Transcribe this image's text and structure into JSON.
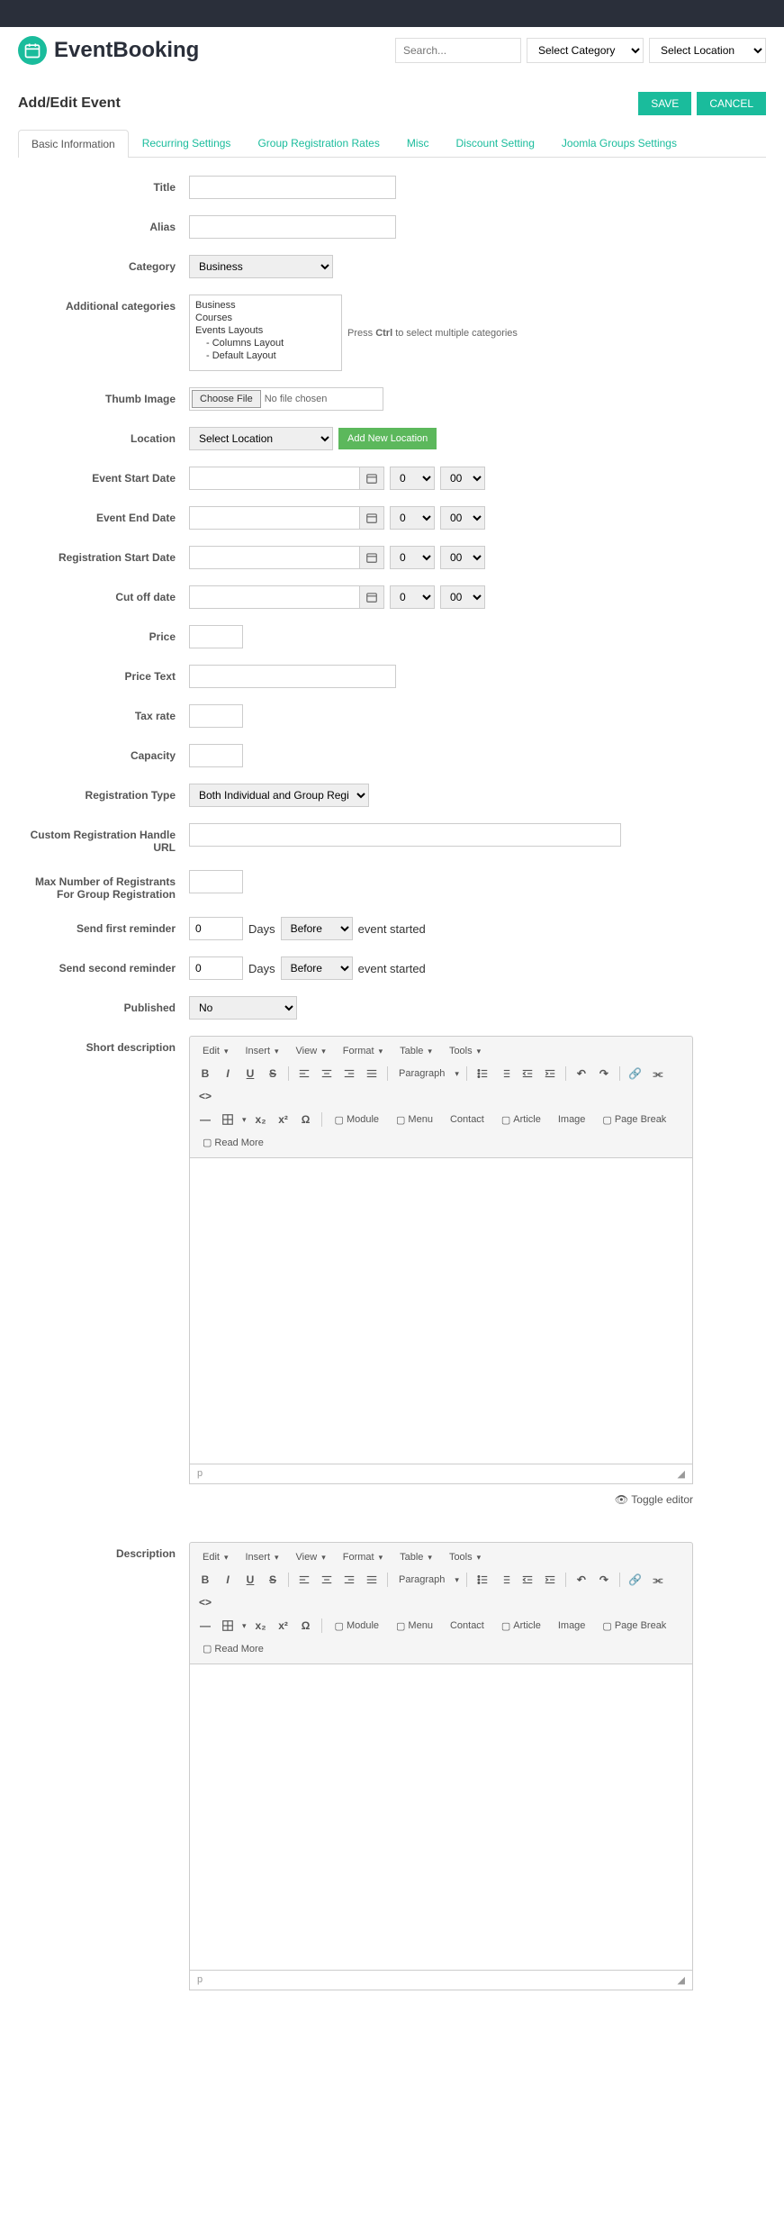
{
  "app_name": "EventBooking",
  "header": {
    "search_placeholder": "Search...",
    "category_placeholder": "Select Category",
    "location_placeholder": "Select Location"
  },
  "page_title": "Add/Edit Event",
  "buttons": {
    "save": "SAVE",
    "cancel": "CANCEL",
    "add_location": "Add New Location",
    "choose_file": "Choose File",
    "no_file": "No file chosen",
    "toggle_editor": "Toggle editor"
  },
  "tabs": [
    "Basic Information",
    "Recurring Settings",
    "Group Registration Rates",
    "Misc",
    "Discount Setting",
    "Joomla Groups Settings"
  ],
  "labels": {
    "title": "Title",
    "alias": "Alias",
    "category": "Category",
    "additional_categories": "Additional categories",
    "thumb_image": "Thumb Image",
    "location": "Location",
    "event_start_date": "Event Start Date",
    "event_end_date": "Event End Date",
    "registration_start_date": "Registration Start Date",
    "cut_off_date": "Cut off date",
    "price": "Price",
    "price_text": "Price Text",
    "tax_rate": "Tax rate",
    "capacity": "Capacity",
    "registration_type": "Registration Type",
    "custom_reg_url": "Custom Registration Handle URL",
    "max_registrants": "Max Number of Registrants For Group Registration",
    "send_first_reminder": "Send first reminder",
    "send_second_reminder": "Send second reminder",
    "published": "Published",
    "short_description": "Short description",
    "description": "Description"
  },
  "values": {
    "category": "Business",
    "additional_categories": [
      "Business",
      "Courses",
      "Events Layouts",
      "- Columns Layout",
      "- Default Layout"
    ],
    "additional_hint_pre": "Press ",
    "additional_hint_key": "Ctrl",
    "additional_hint_post": " to select multiple categories",
    "location": "Select Location",
    "registration_type": "Both Individual and Group Registration",
    "published": "No",
    "reminder_days_1": "0",
    "reminder_days_2": "0",
    "reminder_when_1": "Before",
    "reminder_when_2": "Before",
    "days_label": "Days",
    "event_started": "event started",
    "hour_default": "0",
    "minute_default": "00",
    "editor_status": "p"
  },
  "editor": {
    "menus": [
      "Edit",
      "Insert",
      "View",
      "Format",
      "Table",
      "Tools"
    ],
    "paragraph": "Paragraph",
    "buttons": {
      "module": "Module",
      "menu": "Menu",
      "contact": "Contact",
      "article": "Article",
      "image": "Image",
      "page_break": "Page Break",
      "read_more": "Read More"
    }
  }
}
